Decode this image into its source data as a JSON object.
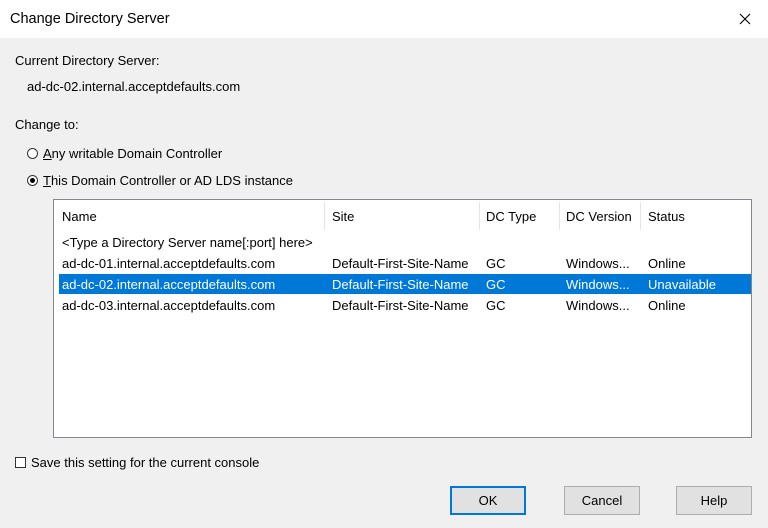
{
  "window": {
    "title": "Change Directory Server"
  },
  "current": {
    "label": "Current Directory Server:",
    "value": "ad-dc-02.internal.acceptdefaults.com"
  },
  "change_to": {
    "label": "Change to:",
    "option_any": {
      "mnemonic": "A",
      "rest": "ny writable Domain Controller",
      "checked": false
    },
    "option_this": {
      "mnemonic": "T",
      "rest": "his Domain Controller or AD LDS instance",
      "checked": true
    }
  },
  "table": {
    "columns": [
      "Name",
      "Site",
      "DC Type",
      "DC Version",
      "Status"
    ],
    "placeholder": "<Type a Directory Server name[:port] here>",
    "rows": [
      {
        "name": "ad-dc-01.internal.acceptdefaults.com",
        "site": "Default-First-Site-Name",
        "type": "GC",
        "version": "Windows...",
        "status": "Online"
      },
      {
        "name": "ad-dc-02.internal.acceptdefaults.com",
        "site": "Default-First-Site-Name",
        "type": "GC",
        "version": "Windows...",
        "status": "Unavailable"
      },
      {
        "name": "ad-dc-03.internal.acceptdefaults.com",
        "site": "Default-First-Site-Name",
        "type": "GC",
        "version": "Windows...",
        "status": "Online"
      }
    ],
    "selected_row": 1
  },
  "save_setting": {
    "label": "Save this setting for the current console",
    "checked": false
  },
  "buttons": {
    "ok": "OK",
    "cancel": "Cancel",
    "help": "Help"
  },
  "colors": {
    "selection": "#0078d7",
    "default_button_border": "#0078d7"
  }
}
